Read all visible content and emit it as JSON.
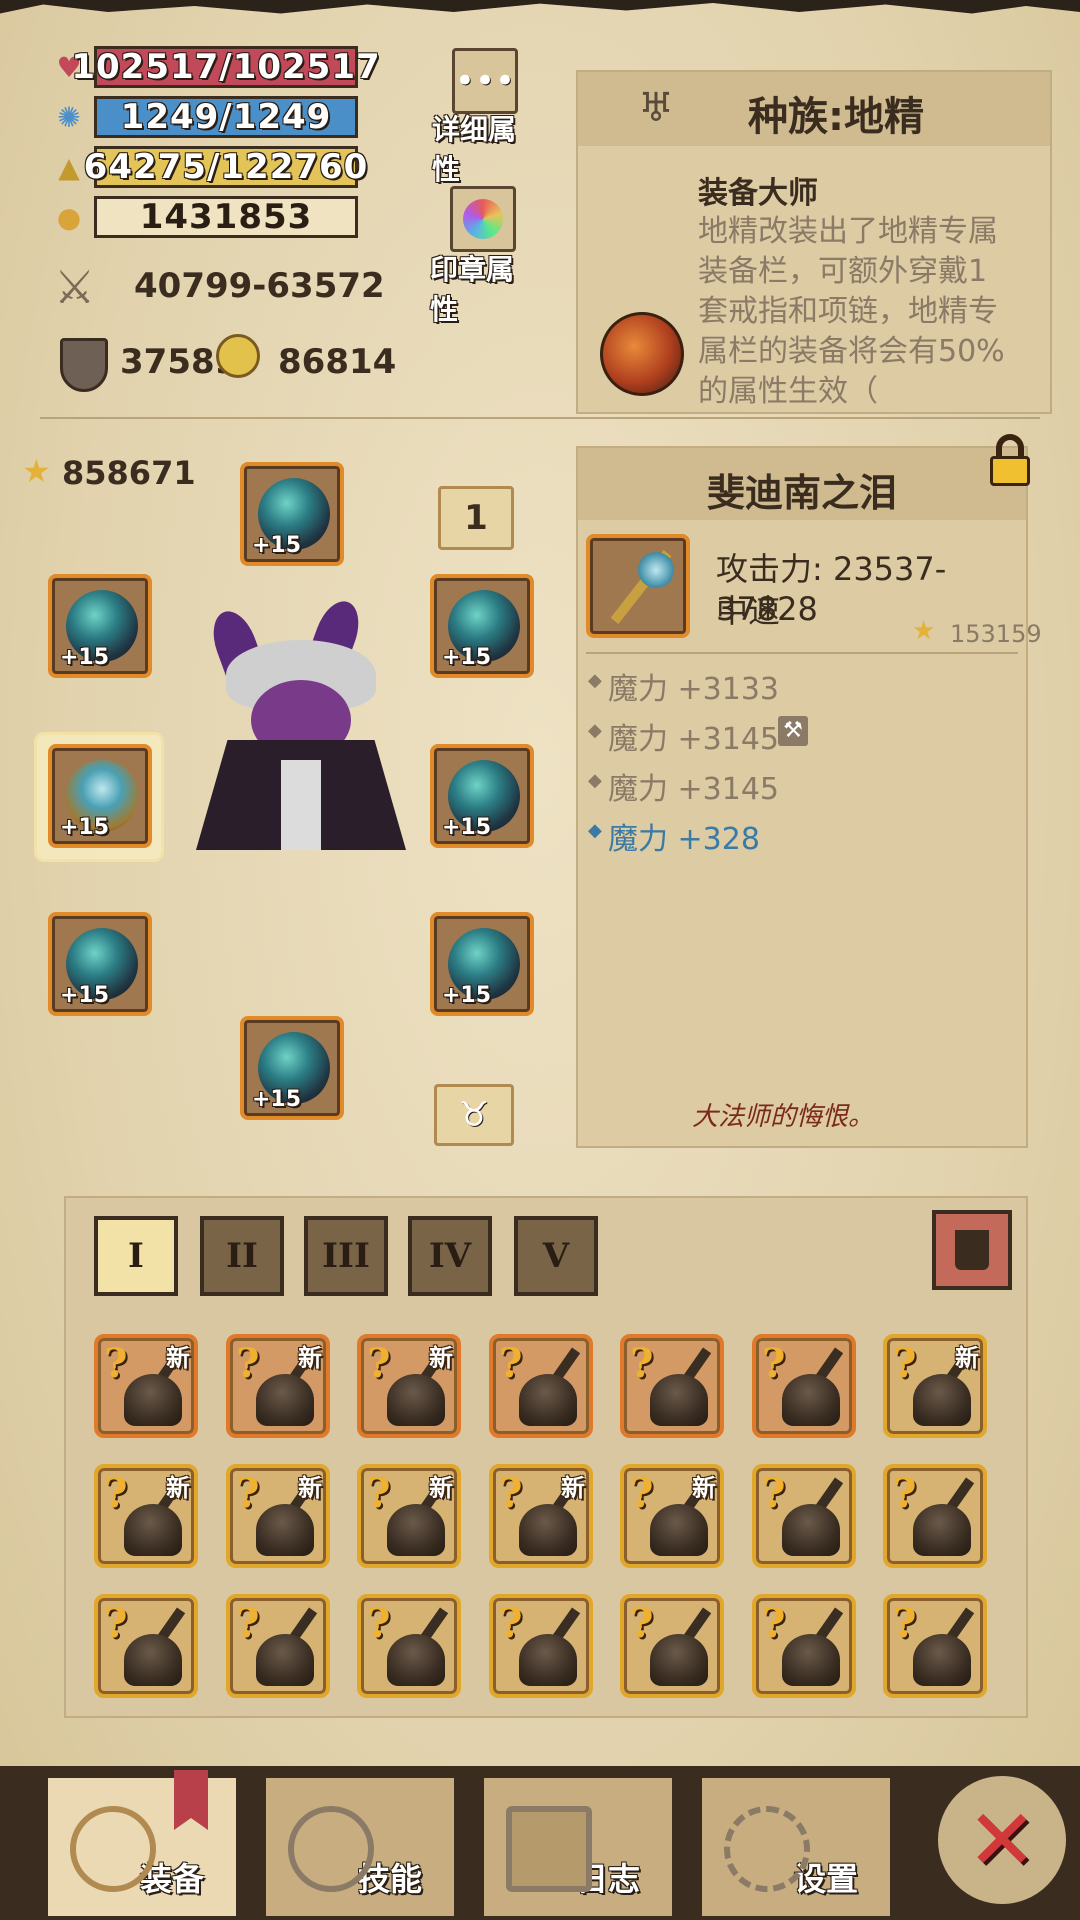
{
  "stats": {
    "hp": "102517/102517",
    "mp": "1249/1249",
    "exp": "64275/122760",
    "gold": "1431853",
    "attack": "40799-63572",
    "defense": "37589",
    "magic": "86814",
    "colors": {
      "hp": "#c2495a",
      "mp": "#4b8fc9",
      "exp": "#e2c458",
      "gold": "#efe3c1"
    }
  },
  "buttons": {
    "detail_attrs": "详细属性",
    "seal_attrs": "印章属性"
  },
  "race": {
    "title": "种族:地精",
    "skill_name": "装备大师",
    "skill_desc": "地精改装出了地精专属装备栏，可额外穿戴1套戒指和项链，地精专属栏的装备将会有50%的属性生效（"
  },
  "hero": {
    "score": "858671",
    "page_number": "1"
  },
  "equip_slots": [
    {
      "name": "helmet",
      "plus": "+15"
    },
    {
      "name": "gloves",
      "plus": "+15"
    },
    {
      "name": "necklace",
      "plus": "+15"
    },
    {
      "name": "weapon",
      "plus": "+15"
    },
    {
      "name": "armor",
      "plus": "+15"
    },
    {
      "name": "bracer",
      "plus": "+15"
    },
    {
      "name": "ring",
      "plus": "+15"
    },
    {
      "name": "boots",
      "plus": "+15"
    }
  ],
  "item": {
    "name": "斐迪南之泪",
    "attack": "攻击力: 23537-37828",
    "speed": "中速",
    "score": "153159",
    "attrs": [
      "魔力 +3133",
      "魔力 +3145",
      "魔力 +3145",
      "魔力 +328"
    ],
    "flavor": "大法师的悔恨。"
  },
  "tabs": [
    "I",
    "II",
    "III",
    "IV",
    "V"
  ],
  "inventory": [
    {
      "new": "新",
      "orange": true
    },
    {
      "new": "新",
      "orange": true
    },
    {
      "new": "新",
      "orange": true
    },
    {
      "new": "",
      "orange": true
    },
    {
      "new": "",
      "orange": true
    },
    {
      "new": "",
      "orange": true
    },
    {
      "new": "新",
      "orange": false
    },
    {
      "new": "新",
      "orange": false
    },
    {
      "new": "新",
      "orange": false
    },
    {
      "new": "新",
      "orange": false
    },
    {
      "new": "新",
      "orange": false
    },
    {
      "new": "新",
      "orange": false
    },
    {
      "new": "",
      "orange": false
    },
    {
      "new": "",
      "orange": false
    },
    {
      "new": "",
      "orange": false
    },
    {
      "new": "",
      "orange": false
    },
    {
      "new": "",
      "orange": false
    },
    {
      "new": "",
      "orange": false
    },
    {
      "new": "",
      "orange": false
    },
    {
      "new": "",
      "orange": false
    },
    {
      "new": "",
      "orange": false
    }
  ],
  "nav": {
    "equip": "装备",
    "skills": "技能",
    "log": "日志",
    "settings": "设置"
  }
}
